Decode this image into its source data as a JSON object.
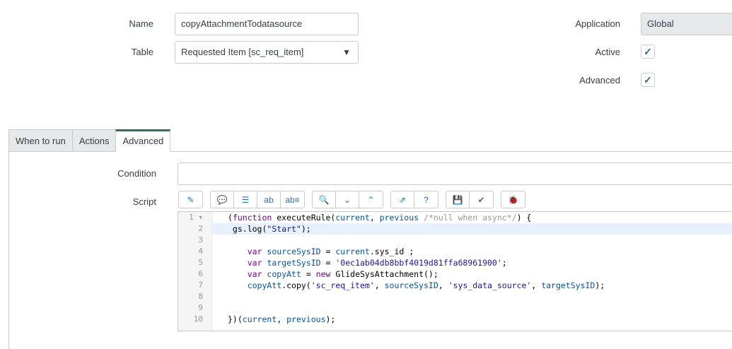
{
  "form": {
    "name_label": "Name",
    "name_value": "copyAttachmentTodatasource",
    "table_label": "Table",
    "table_value": "Requested Item [sc_req_item]",
    "application_label": "Application",
    "application_value": "Global",
    "active_label": "Active",
    "active_checked": true,
    "advanced_label": "Advanced",
    "advanced_checked": true
  },
  "tabs": [
    {
      "label": "When to run"
    },
    {
      "label": "Actions"
    },
    {
      "label": "Advanced"
    }
  ],
  "advanced": {
    "condition_label": "Condition",
    "condition_value": "",
    "script_label": "Script"
  },
  "toolbar": [
    [
      "script-assist-icon"
    ],
    [
      "comment-icon",
      "format-icon",
      "replace-icon",
      "replace-all-icon"
    ],
    [
      "search-icon",
      "search-next-icon",
      "search-previous-icon"
    ],
    [
      "fullscreen-icon",
      "help-icon"
    ],
    [
      "save-icon",
      "script-validate-icon"
    ],
    [
      "debug-icon"
    ]
  ],
  "code": [
    [
      [
        "p",
        "("
      ],
      [
        "k",
        "function"
      ],
      [
        "p",
        " executeRule("
      ],
      [
        "v",
        "current"
      ],
      [
        "p",
        ", "
      ],
      [
        "v",
        "previous"
      ],
      [
        "p",
        " "
      ],
      [
        "c",
        "/*null when async*/"
      ],
      [
        "p",
        ") {"
      ]
    ],
    [
      [
        "p",
        " gs.log("
      ],
      [
        "s",
        "\"Start\""
      ],
      [
        "p",
        ");"
      ]
    ],
    [],
    [
      [
        "p",
        "    "
      ],
      [
        "k",
        "var"
      ],
      [
        "p",
        " "
      ],
      [
        "v",
        "sourceSysID"
      ],
      [
        "p",
        " = "
      ],
      [
        "v",
        "current"
      ],
      [
        "p",
        ".sys_id ;"
      ]
    ],
    [
      [
        "p",
        "    "
      ],
      [
        "k",
        "var"
      ],
      [
        "p",
        " "
      ],
      [
        "v",
        "targetSysID"
      ],
      [
        "p",
        " = "
      ],
      [
        "s",
        "'0ec1ab04db8bbf4019d81ffa68961900'"
      ],
      [
        "p",
        ";"
      ]
    ],
    [
      [
        "p",
        "    "
      ],
      [
        "k",
        "var"
      ],
      [
        "p",
        " "
      ],
      [
        "v",
        "copyAtt"
      ],
      [
        "p",
        " = "
      ],
      [
        "k",
        "new"
      ],
      [
        "p",
        " GlideSysAttachment();"
      ]
    ],
    [
      [
        "p",
        "    "
      ],
      [
        "v",
        "copyAtt"
      ],
      [
        "p",
        ".copy("
      ],
      [
        "s",
        "'sc_req_item'"
      ],
      [
        "p",
        ", "
      ],
      [
        "v",
        "sourceSysID"
      ],
      [
        "p",
        ", "
      ],
      [
        "s",
        "'sys_data_source'"
      ],
      [
        "p",
        ", "
      ],
      [
        "v",
        "targetSysID"
      ],
      [
        "p",
        ");"
      ]
    ],
    [],
    [],
    [
      [
        "p",
        "})("
      ],
      [
        "v",
        "current"
      ],
      [
        "p",
        ", "
      ],
      [
        "v",
        "previous"
      ],
      [
        "p",
        ");"
      ]
    ]
  ],
  "highlighted_line": 2
}
